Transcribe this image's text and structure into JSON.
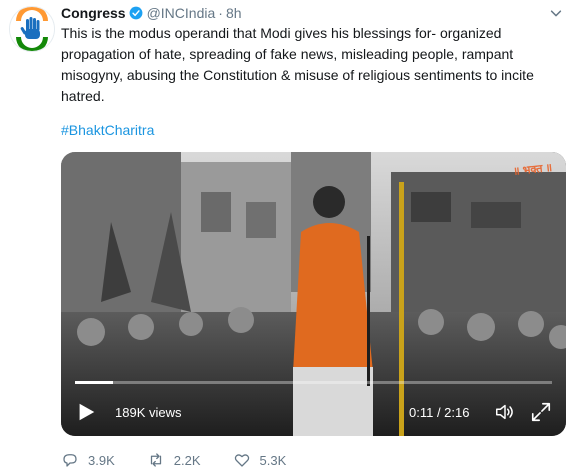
{
  "tweet": {
    "author_name": "Congress",
    "handle": "@INCIndia",
    "separator": "·",
    "time": "8h",
    "text": "This is the modus operandi that Modi gives his blessings for- organized propagation of hate, spreading of fake news, misleading people, rampant misogyny, abusing the Constitution & misuse of religious sentiments to incite hatred.",
    "hashtag": "#BhaktCharitra"
  },
  "video": {
    "views": "189K views",
    "time_display": "0:11 / 2:16",
    "progress": 0.08
  },
  "actions": {
    "replies": "3.9K",
    "retweets": "2.2K",
    "likes": "5.3K"
  },
  "colors": {
    "accent": "#1b95e0",
    "verified": "#1da1f2",
    "muted": "#657786",
    "saffron": "#e8622a"
  },
  "icons": [
    "congress-hand-logo",
    "verified-badge-icon",
    "caret-down-icon",
    "play-icon",
    "volume-icon",
    "fullscreen-icon",
    "reply-icon",
    "retweet-icon",
    "like-icon"
  ]
}
